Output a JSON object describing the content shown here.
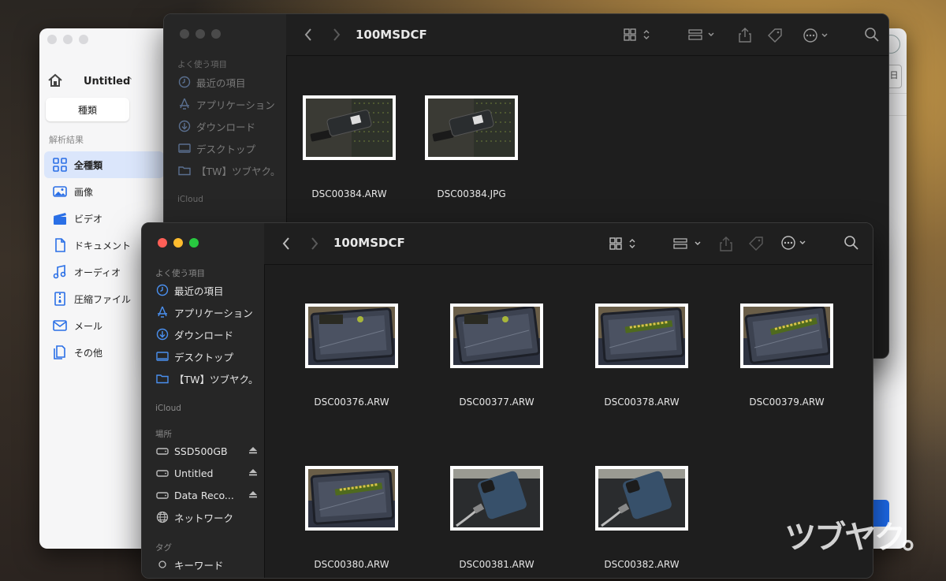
{
  "bg_window": {
    "title": "Untitled",
    "tab_label": "種類",
    "section_label": "解析結果",
    "items": [
      {
        "label": "全種類",
        "icon": "grid-icon",
        "selected": true
      },
      {
        "label": "画像",
        "icon": "photo-icon"
      },
      {
        "label": "ビデオ",
        "icon": "clapper-icon"
      },
      {
        "label": "ドキュメント",
        "icon": "document-icon"
      },
      {
        "label": "オーディオ",
        "icon": "music-note-icon"
      },
      {
        "label": "圧縮ファイル",
        "icon": "archive-icon"
      },
      {
        "label": "メール",
        "icon": "mail-icon"
      },
      {
        "label": "その他",
        "icon": "other-icon"
      }
    ],
    "right_fragment": "日"
  },
  "finder_back": {
    "title": "100MSDCF",
    "sidebar": {
      "favorites_label": "よく使う項目",
      "favorites": [
        "最近の項目",
        "アプリケーション",
        "ダウンロード",
        "デスクトップ",
        "【TW】ツブヤク。"
      ],
      "icloud_label": "iCloud",
      "locations_label": "場所"
    },
    "files": [
      {
        "name": "DSC00384.ARW",
        "image": "usb-ssd-photo"
      },
      {
        "name": "DSC00384.JPG",
        "image": "usb-ssd-photo"
      }
    ]
  },
  "finder_front": {
    "title": "100MSDCF",
    "sidebar": {
      "favorites_label": "よく使う項目",
      "favorites": [
        {
          "label": "最近の項目",
          "icon": "clock-icon"
        },
        {
          "label": "アプリケーション",
          "icon": "apps-icon"
        },
        {
          "label": "ダウンロード",
          "icon": "download-icon"
        },
        {
          "label": "デスクトップ",
          "icon": "desktop-icon"
        },
        {
          "label": "【TW】ツブヤク。",
          "icon": "folder-icon"
        }
      ],
      "icloud_label": "iCloud",
      "locations_label": "場所",
      "locations": [
        {
          "label": "SSD500GB",
          "icon": "drive-icon",
          "eject": true
        },
        {
          "label": "Untitled",
          "icon": "drive-icon",
          "eject": true
        },
        {
          "label": "Data Reco...",
          "icon": "drive-icon",
          "eject": true
        },
        {
          "label": "ネットワーク",
          "icon": "network-icon",
          "eject": false
        }
      ],
      "tags_label": "タグ",
      "tags": [
        {
          "label": "キーワード",
          "icon": "tag-circle-icon"
        }
      ]
    },
    "files": [
      {
        "name": "DSC00376.ARW",
        "image": "ssd-enclosure-photo"
      },
      {
        "name": "DSC00377.ARW",
        "image": "ssd-enclosure-photo"
      },
      {
        "name": "DSC00378.ARW",
        "image": "ssd-enclosure-photo"
      },
      {
        "name": "DSC00379.ARW",
        "image": "ssd-enclosure-photo"
      },
      {
        "name": "DSC00380.ARW",
        "image": "ssd-enclosure-photo"
      },
      {
        "name": "DSC00381.ARW",
        "image": "phone-cable-photo"
      },
      {
        "name": "DSC00382.ARW",
        "image": "phone-cable-photo"
      }
    ]
  },
  "colors": {
    "close": "#ff5f57",
    "minimize": "#febc2e",
    "zoom": "#28c840",
    "accent": "#4a90f0",
    "finder_bg": "#1e1e1e"
  },
  "watermark": "ツブヤク。"
}
